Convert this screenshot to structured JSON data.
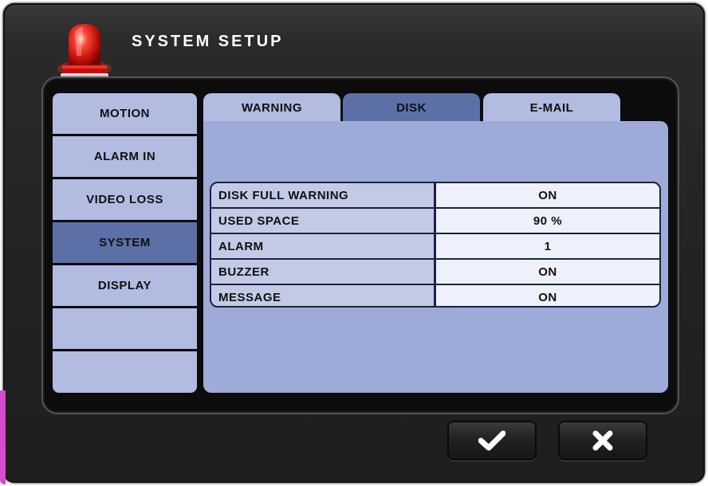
{
  "header": {
    "title": "SYSTEM SETUP",
    "icon": "alarm-beacon-icon"
  },
  "sidebar": {
    "items": [
      {
        "label": "MOTION",
        "active": false
      },
      {
        "label": "ALARM IN",
        "active": false
      },
      {
        "label": "VIDEO LOSS",
        "active": false
      },
      {
        "label": "SYSTEM",
        "active": true
      },
      {
        "label": "DISPLAY",
        "active": false
      },
      {
        "label": "",
        "active": false
      },
      {
        "label": "",
        "active": false
      }
    ]
  },
  "tabs": [
    {
      "label": "WARNING",
      "active": false
    },
    {
      "label": "DISK",
      "active": true
    },
    {
      "label": "E-MAIL",
      "active": false
    }
  ],
  "settings": {
    "rows": [
      {
        "label": "DISK FULL WARNING",
        "value": "ON"
      },
      {
        "label": "USED SPACE",
        "value": "90 %"
      },
      {
        "label": "ALARM",
        "value": "1"
      },
      {
        "label": "BUZZER",
        "value": "ON"
      },
      {
        "label": "MESSAGE",
        "value": "ON"
      }
    ]
  },
  "buttons": {
    "confirm_icon": "checkmark-icon",
    "cancel_icon": "close-icon"
  },
  "colors": {
    "active_tab": "#5c6fa6",
    "inactive_tab": "#b2bbe0",
    "panel": "#9eaad8"
  }
}
